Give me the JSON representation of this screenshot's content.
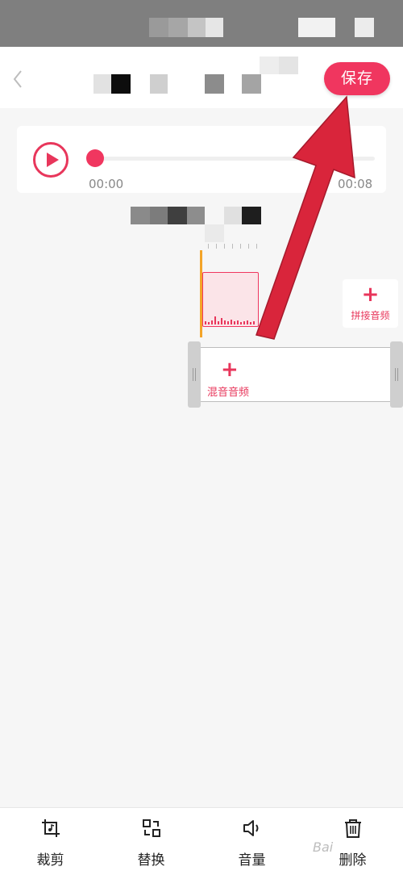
{
  "header": {
    "save_label": "保存"
  },
  "player": {
    "current_time": "00:00",
    "total_time": "00:08",
    "progress": 0
  },
  "editor": {
    "append_audio_label": "拼接音频",
    "mix_audio_label": "混音音频"
  },
  "toolbar": {
    "items": [
      {
        "label": "裁剪",
        "icon": "crop-icon"
      },
      {
        "label": "替换",
        "icon": "replace-icon"
      },
      {
        "label": "音量",
        "icon": "volume-icon"
      },
      {
        "label": "删除",
        "icon": "trash-icon"
      }
    ]
  },
  "watermark": "Bai",
  "colors": {
    "accent": "#f0365f",
    "playhead": "#f3a429",
    "annotation_arrow": "#d9253b"
  }
}
